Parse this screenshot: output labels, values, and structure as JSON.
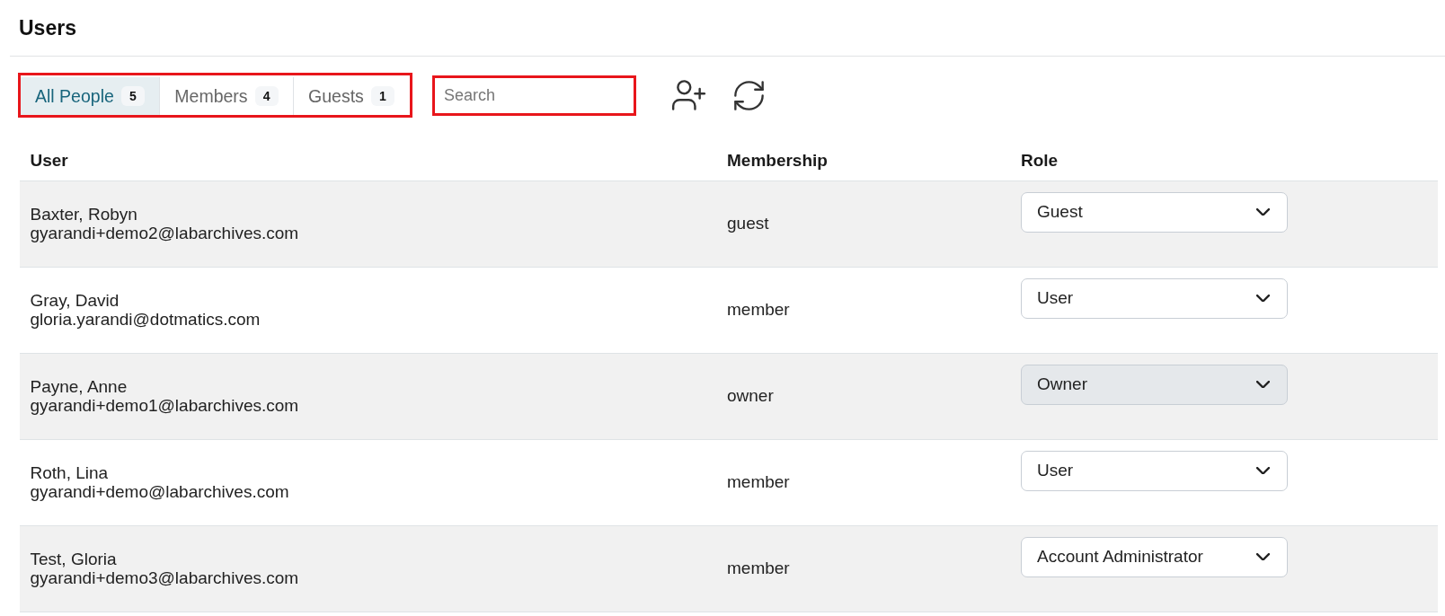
{
  "page": {
    "title": "Users"
  },
  "toolbar": {
    "tabs_highlighted": true,
    "tabs": [
      {
        "label": "All People",
        "count": "5",
        "selected": true
      },
      {
        "label": "Members",
        "count": "4",
        "selected": false
      },
      {
        "label": "Guests",
        "count": "1",
        "selected": false
      }
    ],
    "search": {
      "placeholder": "Search",
      "highlighted": true
    }
  },
  "table": {
    "columns": [
      "User",
      "Membership",
      "Role"
    ],
    "rows": [
      {
        "name": "Baxter, Robyn",
        "email": "gyarandi+demo2@labarchives.com",
        "membership": "guest",
        "role": {
          "value": "Guest",
          "disabled": false
        }
      },
      {
        "name": "Gray, David",
        "email": "gloria.yarandi@dotmatics.com",
        "membership": "member",
        "role": {
          "value": "User",
          "disabled": false
        }
      },
      {
        "name": "Payne, Anne",
        "email": "gyarandi+demo1@labarchives.com",
        "membership": "owner",
        "role": {
          "value": "Owner",
          "disabled": true
        }
      },
      {
        "name": "Roth, Lina",
        "email": "gyarandi+demo@labarchives.com",
        "membership": "member",
        "role": {
          "value": "User",
          "disabled": false
        }
      },
      {
        "name": "Test, Gloria",
        "email": "gyarandi+demo3@labarchives.com",
        "membership": "member",
        "role": {
          "value": "Account Administrator",
          "disabled": false
        }
      }
    ]
  }
}
